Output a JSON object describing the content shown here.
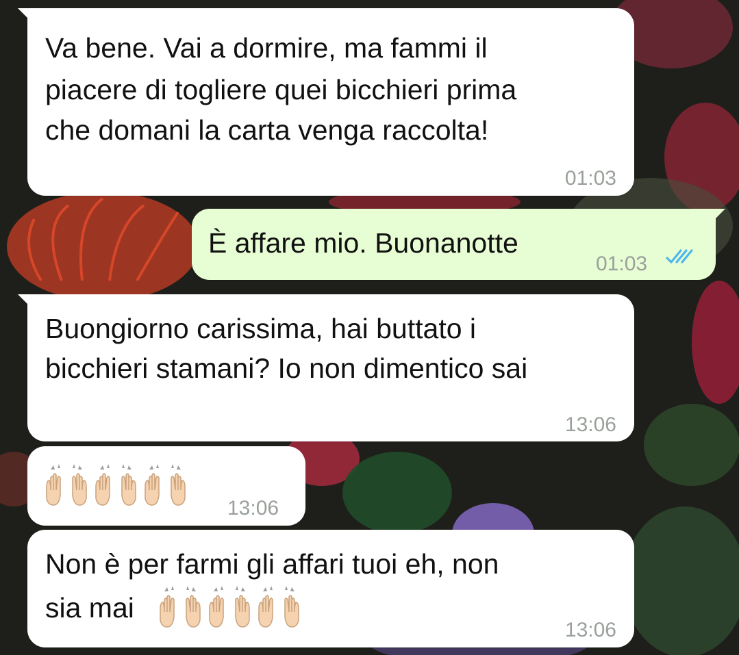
{
  "chat": {
    "messages": [
      {
        "direction": "incoming",
        "lines": [
          "Va bene. Vai a dormire, ma fammi il",
          "piacere di togliere quei bicchieri prima",
          "che domani la carta venga raccolta!"
        ],
        "time": "01:03"
      },
      {
        "direction": "outgoing",
        "lines": [
          "È affare mio. Buonanotte"
        ],
        "time": "01:03",
        "status": "read"
      },
      {
        "direction": "incoming",
        "lines": [
          "Buongiorno carissima, hai buttato i",
          "bicchieri stamani? Io non dimentico sai"
        ],
        "time": "13:06"
      },
      {
        "direction": "incoming",
        "emoji": "raising-hands-emoji x3",
        "time": "13:06"
      },
      {
        "direction": "incoming",
        "lines": [
          "Non è per farmi gli affari tuoi eh, non",
          "sia mai"
        ],
        "emoji": "raising-hands-emoji x3",
        "time": "13:06"
      }
    ]
  },
  "colors": {
    "incoming_bubble": "#ffffff",
    "outgoing_bubble": "#e7fdd3",
    "timestamp": "#9aa09a",
    "read_ticks": "#4fb6ec"
  }
}
